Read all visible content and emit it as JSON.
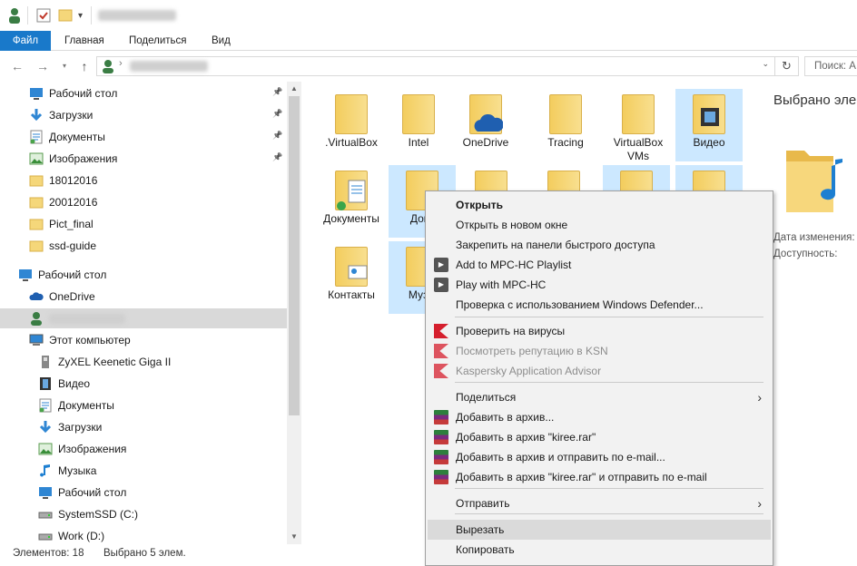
{
  "window": {
    "qa_title_blurred": "",
    "ribbon_tabs": [
      "Файл",
      "Главная",
      "Поделиться",
      "Вид"
    ]
  },
  "address": {
    "search_placeholder": "Поиск: А"
  },
  "nav": {
    "items": [
      {
        "label": "Рабочий стол",
        "icon": "desktop-icon",
        "pinned": true
      },
      {
        "label": "Загрузки",
        "icon": "download-icon",
        "pinned": true
      },
      {
        "label": "Документы",
        "icon": "documents-icon",
        "pinned": true
      },
      {
        "label": "Изображения",
        "icon": "pictures-icon",
        "pinned": true
      },
      {
        "label": "18012016",
        "icon": "folder-icon",
        "pinned": false
      },
      {
        "label": "20012016",
        "icon": "folder-icon",
        "pinned": false
      },
      {
        "label": "Pict_final",
        "icon": "folder-icon",
        "pinned": false
      },
      {
        "label": "ssd-guide",
        "icon": "folder-icon",
        "pinned": false
      },
      {
        "label": "Рабочий стол",
        "icon": "desktop-icon",
        "pinned": false
      },
      {
        "label": "OneDrive",
        "icon": "cloud-icon",
        "pinned": false
      },
      {
        "label": "",
        "icon": "user-icon",
        "pinned": false
      },
      {
        "label": "Этот компьютер",
        "icon": "computer-icon",
        "pinned": false
      },
      {
        "label": "ZyXEL Keenetic Giga II",
        "icon": "media-device-icon",
        "pinned": false
      },
      {
        "label": "Видео",
        "icon": "video-icon",
        "pinned": false
      },
      {
        "label": "Документы",
        "icon": "documents-icon",
        "pinned": false
      },
      {
        "label": "Загрузки",
        "icon": "download-icon",
        "pinned": false
      },
      {
        "label": "Изображения",
        "icon": "pictures-icon",
        "pinned": false
      },
      {
        "label": "Музыка",
        "icon": "music-icon",
        "pinned": false
      },
      {
        "label": "Рабочий стол",
        "icon": "desktop-icon",
        "pinned": false
      },
      {
        "label": "SystemSSD (C:)",
        "icon": "drive-icon",
        "pinned": false
      },
      {
        "label": "Work (D:)",
        "icon": "drive-icon",
        "pinned": false
      }
    ]
  },
  "content": {
    "tiles": [
      {
        "label": ".VirtualBox",
        "selected": false
      },
      {
        "label": "Intel",
        "selected": false
      },
      {
        "label": "OneDrive",
        "selected": false
      },
      {
        "label": "Tracing",
        "selected": false
      },
      {
        "label": "VirtualBox VMs",
        "selected": false
      },
      {
        "label": "Видео",
        "selected": true
      },
      {
        "label": "Документы",
        "selected": false
      },
      {
        "label": "Доку",
        "selected": true
      },
      {
        "label": "Контакты",
        "selected": false
      },
      {
        "label": "Музы",
        "selected": true
      }
    ]
  },
  "details": {
    "title": "Выбрано эле",
    "date_label": "Дата изменения:",
    "access_label": "Доступность:"
  },
  "status": {
    "items_count": "Элементов: 18",
    "selected_count": "Выбрано 5 элем."
  },
  "menu": {
    "items": [
      {
        "label": "Открыть",
        "bold": true,
        "icon": ""
      },
      {
        "label": "Открыть в новом окне",
        "icon": ""
      },
      {
        "label": "Закрепить на панели быстрого доступа",
        "icon": ""
      },
      {
        "label": "Add to MPC-HC Playlist",
        "icon": "mpc-icon"
      },
      {
        "label": "Play with MPC-HC",
        "icon": "mpc-icon"
      },
      {
        "label": "Проверка с использованием Windows Defender...",
        "icon": ""
      },
      {
        "label": "Проверить на вирусы",
        "icon": "kaspersky-icon"
      },
      {
        "label": "Посмотреть репутацию в KSN",
        "icon": "kaspersky-icon",
        "disabled": true
      },
      {
        "label": "Kaspersky Application Advisor",
        "icon": "kaspersky-icon",
        "disabled": true
      },
      {
        "label": "Поделиться",
        "icon": "",
        "submenu": true
      },
      {
        "label": "Добавить в архив...",
        "icon": "winrar-icon"
      },
      {
        "label": "Добавить в архив \"kiree.rar\"",
        "icon": "winrar-icon"
      },
      {
        "label": "Добавить в архив и отправить по e-mail...",
        "icon": "winrar-icon"
      },
      {
        "label": "Добавить в архив \"kiree.rar\" и отправить по e-mail",
        "icon": "winrar-icon"
      },
      {
        "label": "Отправить",
        "icon": "",
        "submenu": true
      },
      {
        "label": "Вырезать",
        "icon": "",
        "highlighted": true
      },
      {
        "label": "Копировать",
        "icon": ""
      }
    ],
    "submenu_glyph": "›"
  }
}
